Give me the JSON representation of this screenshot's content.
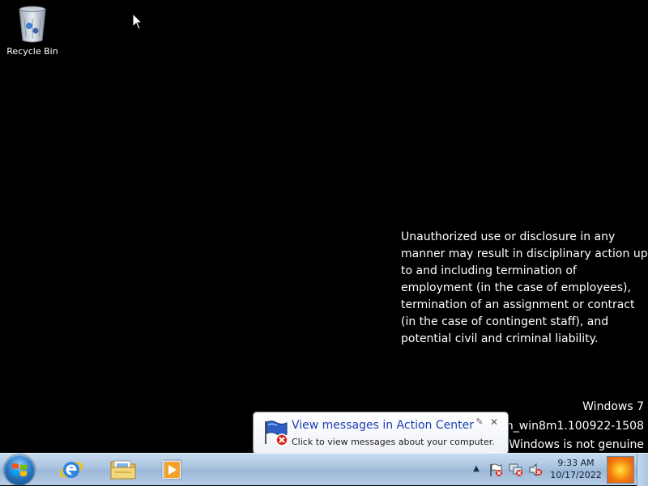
{
  "desktop": {
    "icons": [
      {
        "label": "Recycle Bin",
        "icon": "recycle-bin-icon"
      }
    ],
    "notice": "Unauthorized use or disclosure in any manner may result in disciplinary action up to and including termination of employment (in the case of employees), termination of an assignment or contract (in the case of contingent staff), and potential civil and criminal liability.",
    "watermark": {
      "os": "Windows 7",
      "build": "ain_win8m1.100922-1508",
      "genuine": "Windows is not genuine"
    }
  },
  "balloon": {
    "title": "View messages in Action Center",
    "body": "Click to view messages about your computer.",
    "icon": "action-center-flag-icon",
    "options_glyph": "✎",
    "close_glyph": "✕"
  },
  "taskbar": {
    "pinned": [
      {
        "name": "internet-explorer",
        "icon": "internet-explorer-icon"
      },
      {
        "name": "windows-explorer",
        "icon": "folder-icon"
      },
      {
        "name": "windows-media-player",
        "icon": "media-player-icon"
      }
    ],
    "tray": {
      "expand_glyph": "▲",
      "icons": [
        "action-center-flag-icon",
        "network-icon",
        "volume-muted-icon"
      ]
    },
    "clock": {
      "time": "9:33 AM",
      "date": "10/17/2022"
    }
  },
  "colors": {
    "desktop_bg": "#000000",
    "taskbar": "#a8c2df",
    "balloon_title": "#1c3fb0"
  }
}
